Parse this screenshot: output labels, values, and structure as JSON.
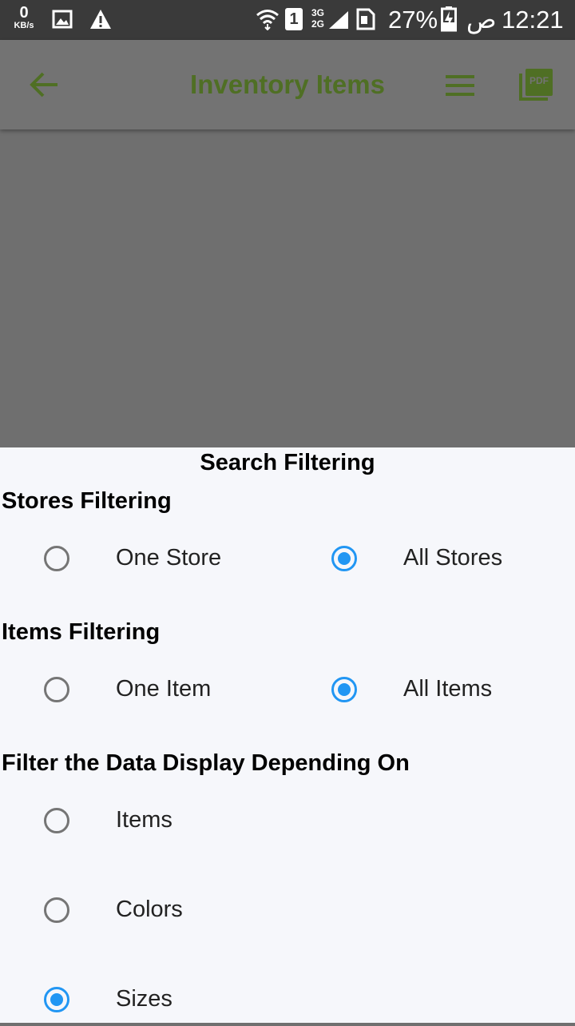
{
  "status_bar": {
    "speed_value": "0",
    "speed_unit": "KB/s",
    "sim_slot": "1",
    "network_top": "3G",
    "network_bottom": "2G",
    "battery": "27%",
    "ampm": "ص",
    "time": "12:21"
  },
  "app_bar": {
    "title": "Inventory Items",
    "pdf_label": "PDF"
  },
  "sheet": {
    "title": "Search Filtering",
    "stores": {
      "heading": "Stores Filtering",
      "options": [
        {
          "label": "One Store",
          "selected": false
        },
        {
          "label": "All Stores",
          "selected": true
        }
      ]
    },
    "items": {
      "heading": "Items Filtering",
      "options": [
        {
          "label": "One Item",
          "selected": false
        },
        {
          "label": "All Items",
          "selected": true
        }
      ]
    },
    "display": {
      "heading": "Filter the Data Display Depending On",
      "options": [
        {
          "label": "Items",
          "selected": false
        },
        {
          "label": "Colors",
          "selected": false
        },
        {
          "label": "Sizes",
          "selected": true
        }
      ]
    }
  },
  "colors": {
    "accent": "#2196f3",
    "title_green": "#4f6f24",
    "scrim": "#6f6f6f"
  }
}
